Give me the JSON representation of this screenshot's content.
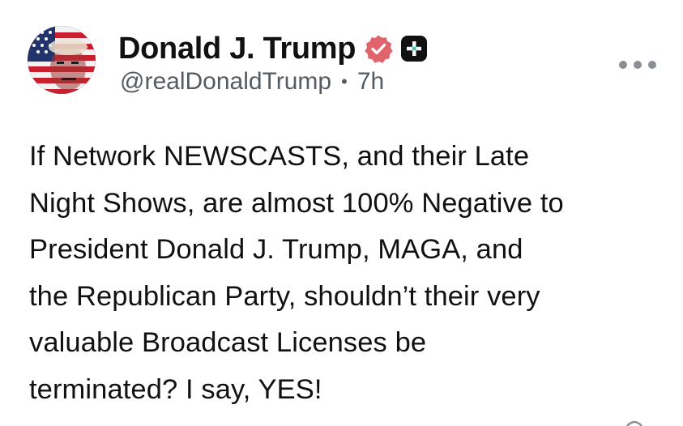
{
  "author": {
    "display_name": "Donald J. Trump",
    "handle": "@realDonaldTrump",
    "time_ago": "7h",
    "separator": "•",
    "avatar_icon": "avatar-flag-portrait",
    "verified_icon": "verified-badge-icon",
    "plus_icon": "plus-badge-icon"
  },
  "post": {
    "text": "If Network NEWSCASTS, and their Late\nNight Shows, are almost 100% Negative to\nPresident Donald J. Trump, MAGA, and\nthe Republican Party, shouldn’t their very\nvaluable Broadcast Licenses be\nterminated? I say, YES!"
  },
  "actions": {
    "more_icon": "more-options-icon"
  },
  "colors": {
    "verified": "#e0646b",
    "plus_bg": "#111111",
    "meta_text": "#555b63",
    "more_dots": "#8a8f96"
  }
}
